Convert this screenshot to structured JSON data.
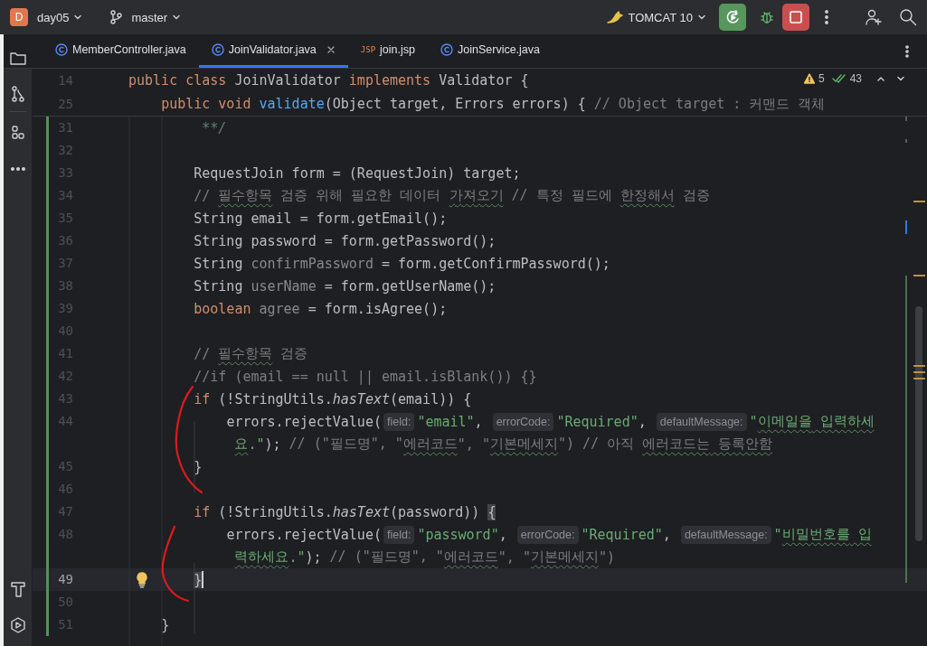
{
  "title_bar": {
    "project_badge": "D",
    "project": "day05",
    "branch": "master",
    "run_config": "TOMCAT 10"
  },
  "tabs": [
    {
      "label": "MemberController.java",
      "kind": "class",
      "selected": false
    },
    {
      "label": "JoinValidator.java",
      "kind": "class",
      "selected": true
    },
    {
      "label": "join.jsp",
      "kind": "jsp",
      "icon_label": "JSP",
      "selected": false
    },
    {
      "label": "JoinService.java",
      "kind": "class",
      "selected": false
    }
  ],
  "inspections": {
    "warnings": "5",
    "passed": "43"
  },
  "sticky_lines": [
    {
      "number": "14",
      "rows": [
        {
          "indent": "",
          "tokens": [
            {
              "t": "public class ",
              "kind": "keyword"
            },
            {
              "t": "JoinValidator ",
              "kind": "plain"
            },
            {
              "t": "implements ",
              "kind": "keyword"
            },
            {
              "t": "Validator {",
              "kind": "plain"
            }
          ]
        }
      ]
    },
    {
      "number": "25",
      "rows": [
        {
          "indent": "    ",
          "tokens": [
            {
              "t": "public void ",
              "kind": "keyword"
            },
            {
              "t": "validate",
              "kind": "method"
            },
            {
              "t": "(Object target, Errors errors) { ",
              "kind": "plain"
            },
            {
              "t": "// Object target : 커맨드 객체",
              "kind": "comment"
            }
          ]
        }
      ]
    }
  ],
  "lines": [
    {
      "number": "31",
      "current": false,
      "rows": [
        {
          "indent": "         ",
          "tokens": [
            {
              "t": "**/",
              "kind": "doc"
            }
          ]
        }
      ]
    },
    {
      "number": "32",
      "current": false,
      "rows": [
        {
          "indent": "",
          "tokens": []
        }
      ]
    },
    {
      "number": "33",
      "current": false,
      "rows": [
        {
          "indent": "        ",
          "tokens": [
            {
              "t": "RequestJoin form = (RequestJoin) target;",
              "kind": "plain"
            }
          ]
        }
      ]
    },
    {
      "number": "34",
      "current": false,
      "rows": [
        {
          "indent": "        ",
          "tokens": [
            {
              "t": "// ",
              "kind": "comment"
            },
            {
              "t": "필수항목",
              "kind": "typo-comment"
            },
            {
              "t": " 검증 위해 필요한 데이터 ",
              "kind": "comment"
            },
            {
              "t": "가져오기",
              "kind": "typo-comment"
            },
            {
              "t": " // 특정 필드에 ",
              "kind": "comment"
            },
            {
              "t": "한정해서",
              "kind": "typo-comment"
            },
            {
              "t": " 검증",
              "kind": "comment"
            }
          ]
        }
      ]
    },
    {
      "number": "35",
      "current": false,
      "rows": [
        {
          "indent": "        ",
          "tokens": [
            {
              "t": "String email = form.getEmail();",
              "kind": "plain"
            }
          ]
        }
      ]
    },
    {
      "number": "36",
      "current": false,
      "rows": [
        {
          "indent": "        ",
          "tokens": [
            {
              "t": "String password = form.getPassword();",
              "kind": "plain"
            }
          ]
        }
      ]
    },
    {
      "number": "37",
      "current": false,
      "rows": [
        {
          "indent": "        ",
          "tokens": [
            {
              "t": "String ",
              "kind": "plain"
            },
            {
              "t": "confirmPassword",
              "kind": "unused"
            },
            {
              "t": " = form.getConfirmPassword();",
              "kind": "plain"
            }
          ]
        }
      ]
    },
    {
      "number": "38",
      "current": false,
      "rows": [
        {
          "indent": "        ",
          "tokens": [
            {
              "t": "String ",
              "kind": "plain"
            },
            {
              "t": "userName",
              "kind": "unused"
            },
            {
              "t": " = form.getUserName();",
              "kind": "plain"
            }
          ]
        }
      ]
    },
    {
      "number": "39",
      "current": false,
      "rows": [
        {
          "indent": "        ",
          "tokens": [
            {
              "t": "boolean ",
              "kind": "keyword"
            },
            {
              "t": "agree",
              "kind": "unused"
            },
            {
              "t": " = form.isAgree();",
              "kind": "plain"
            }
          ]
        }
      ]
    },
    {
      "number": "40",
      "current": false,
      "rows": [
        {
          "indent": "",
          "tokens": []
        }
      ]
    },
    {
      "number": "41",
      "current": false,
      "rows": [
        {
          "indent": "        ",
          "tokens": [
            {
              "t": "// ",
              "kind": "comment"
            },
            {
              "t": "필수항목",
              "kind": "typo-comment"
            },
            {
              "t": " 검증",
              "kind": "comment"
            }
          ]
        }
      ]
    },
    {
      "number": "42",
      "current": false,
      "rows": [
        {
          "indent": "        ",
          "tokens": [
            {
              "t": "//if (email == null || email.isBlank()) {}",
              "kind": "comment"
            }
          ]
        }
      ]
    },
    {
      "number": "43",
      "current": false,
      "rows": [
        {
          "indent": "        ",
          "tokens": [
            {
              "t": "if ",
              "kind": "keyword"
            },
            {
              "t": "(!StringUtils.",
              "kind": "plain"
            },
            {
              "t": "hasText",
              "kind": "static"
            },
            {
              "t": "(email)) {",
              "kind": "plain"
            }
          ]
        }
      ]
    },
    {
      "number": "44",
      "current": false,
      "rows": [
        {
          "indent": "            ",
          "tokens": [
            {
              "t": "errors.rejectValue(",
              "kind": "plain"
            },
            {
              "t": "field:",
              "kind": "hint"
            },
            {
              "t": "\"email\"",
              "kind": "string"
            },
            {
              "t": ", ",
              "kind": "plain"
            },
            {
              "t": "errorCode:",
              "kind": "hint"
            },
            {
              "t": "\"Required\"",
              "kind": "string"
            },
            {
              "t": ", ",
              "kind": "plain"
            },
            {
              "t": "defaultMessage:",
              "kind": "hint"
            },
            {
              "t": "\"",
              "kind": "string"
            },
            {
              "t": "이메일을",
              "kind": "typo-string"
            },
            {
              "t": " 입력하세",
              "kind": "typo-string"
            }
          ]
        },
        {
          "indent": "             ",
          "tokens": [
            {
              "t": "요",
              "kind": "typo-string"
            },
            {
              "t": ".\"",
              "kind": "string"
            },
            {
              "t": "); ",
              "kind": "plain"
            },
            {
              "t": "// (\"필드명\", \"",
              "kind": "comment"
            },
            {
              "t": "에러코드",
              "kind": "typo-comment"
            },
            {
              "t": "\", \"",
              "kind": "comment"
            },
            {
              "t": "기본메세지",
              "kind": "typo-comment"
            },
            {
              "t": "\") // 아직 ",
              "kind": "comment"
            },
            {
              "t": "에러코드는",
              "kind": "typo-comment"
            },
            {
              "t": " 등록안함",
              "kind": "typo-comment"
            }
          ]
        }
      ]
    },
    {
      "number": "45",
      "current": false,
      "rows": [
        {
          "indent": "        ",
          "tokens": [
            {
              "t": "}",
              "kind": "plain"
            }
          ]
        }
      ]
    },
    {
      "number": "46",
      "current": false,
      "rows": [
        {
          "indent": "",
          "tokens": []
        }
      ]
    },
    {
      "number": "47",
      "current": false,
      "rows": [
        {
          "indent": "        ",
          "tokens": [
            {
              "t": "if ",
              "kind": "keyword"
            },
            {
              "t": "(!StringUtils.",
              "kind": "plain"
            },
            {
              "t": "hasText",
              "kind": "static"
            },
            {
              "t": "(password)) ",
              "kind": "plain"
            },
            {
              "t": "{",
              "kind": "brace-match"
            }
          ]
        }
      ]
    },
    {
      "number": "48",
      "current": false,
      "rows": [
        {
          "indent": "            ",
          "tokens": [
            {
              "t": "errors.rejectValue(",
              "kind": "plain"
            },
            {
              "t": "field:",
              "kind": "hint"
            },
            {
              "t": "\"password\"",
              "kind": "string"
            },
            {
              "t": ", ",
              "kind": "plain"
            },
            {
              "t": "errorCode:",
              "kind": "hint"
            },
            {
              "t": "\"Required\"",
              "kind": "string"
            },
            {
              "t": ", ",
              "kind": "plain"
            },
            {
              "t": "defaultMessage:",
              "kind": "hint"
            },
            {
              "t": "\"",
              "kind": "string"
            },
            {
              "t": "비밀번호를",
              "kind": "typo-string"
            },
            {
              "t": " 입",
              "kind": "typo-string"
            }
          ]
        },
        {
          "indent": "             ",
          "tokens": [
            {
              "t": "력하세요",
              "kind": "typo-string"
            },
            {
              "t": ".\"",
              "kind": "string"
            },
            {
              "t": "); ",
              "kind": "plain"
            },
            {
              "t": "// (\"필드명\", \"",
              "kind": "comment"
            },
            {
              "t": "에러코드",
              "kind": "typo-comment"
            },
            {
              "t": "\", \"",
              "kind": "comment"
            },
            {
              "t": "기본메세지",
              "kind": "typo-comment"
            },
            {
              "t": "\")",
              "kind": "comment"
            }
          ]
        }
      ]
    },
    {
      "number": "49",
      "current": true,
      "rows": [
        {
          "indent": "        ",
          "tokens": [
            {
              "t": "}",
              "kind": "brace-match"
            }
          ]
        }
      ]
    },
    {
      "number": "50",
      "current": false,
      "rows": [
        {
          "indent": "",
          "tokens": []
        }
      ]
    },
    {
      "number": "51",
      "current": false,
      "rows": [
        {
          "indent": "    ",
          "tokens": [
            {
              "t": "}",
              "kind": "plain"
            }
          ]
        }
      ]
    }
  ]
}
